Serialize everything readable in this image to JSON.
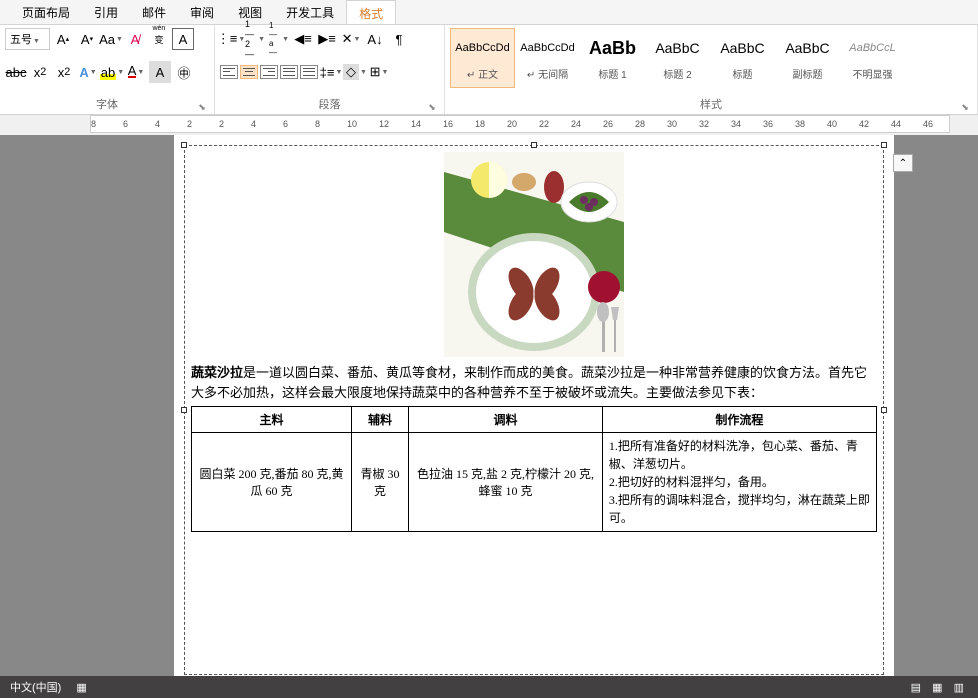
{
  "tabs": {
    "items": [
      "页面布局",
      "引用",
      "邮件",
      "审阅",
      "视图",
      "开发工具",
      "格式"
    ],
    "active": "格式"
  },
  "ribbon": {
    "font_size": "五号",
    "group_font": "字体",
    "group_para": "段落",
    "group_styles": "样式"
  },
  "styles": [
    {
      "preview": "AaBbCcDd",
      "name": "↵ 正文",
      "size": "sm",
      "sel": true
    },
    {
      "preview": "AaBbCcDd",
      "name": "↵ 无间隔",
      "size": "sm"
    },
    {
      "preview": "AaBb",
      "name": "标题 1",
      "size": "big"
    },
    {
      "preview": "AaBbC",
      "name": "标题 2",
      "size": "med"
    },
    {
      "preview": "AaBbC",
      "name": "标题",
      "size": "med"
    },
    {
      "preview": "AaBbC",
      "name": "副标题",
      "size": "med"
    },
    {
      "preview": "AaBbCcL",
      "name": "不明显强",
      "size": "sm",
      "ital": true
    }
  ],
  "ruler_ticks": [
    8,
    6,
    4,
    2,
    2,
    4,
    6,
    8,
    10,
    12,
    14,
    16,
    18,
    20,
    22,
    24,
    26,
    28,
    30,
    32,
    34,
    36,
    38,
    40,
    42,
    44,
    46
  ],
  "doc": {
    "para_bold": "蔬菜沙拉",
    "para_rest": "是一道以圆白菜、番茄、黄瓜等食材，来制作而成的美食。蔬菜沙拉是一种非常营养健康的饮食方法。首先它大多不必加热，这样会最大限度地保持蔬菜中的各种营养不至于被破坏或流失。主要做法参见下表：",
    "table": {
      "headers": [
        "主料",
        "辅料",
        "调料",
        "制作流程"
      ],
      "cells": {
        "main": "圆白菜 200 克,番茄 80 克,黄瓜 60 克",
        "aux": "青椒 30 克",
        "season": "色拉油 15 克,盐 2 克,柠檬汁 20 克,蜂蜜 10 克",
        "proc": "1.把所有准备好的材料洗净，包心菜、番茄、青椒、洋葱切片。\n2.把切好的材料混拌匀，备用。\n3.把所有的调味料混合，搅拌均匀，淋在蔬菜上即可。"
      }
    }
  },
  "status": {
    "lang": "中文(中国)"
  }
}
